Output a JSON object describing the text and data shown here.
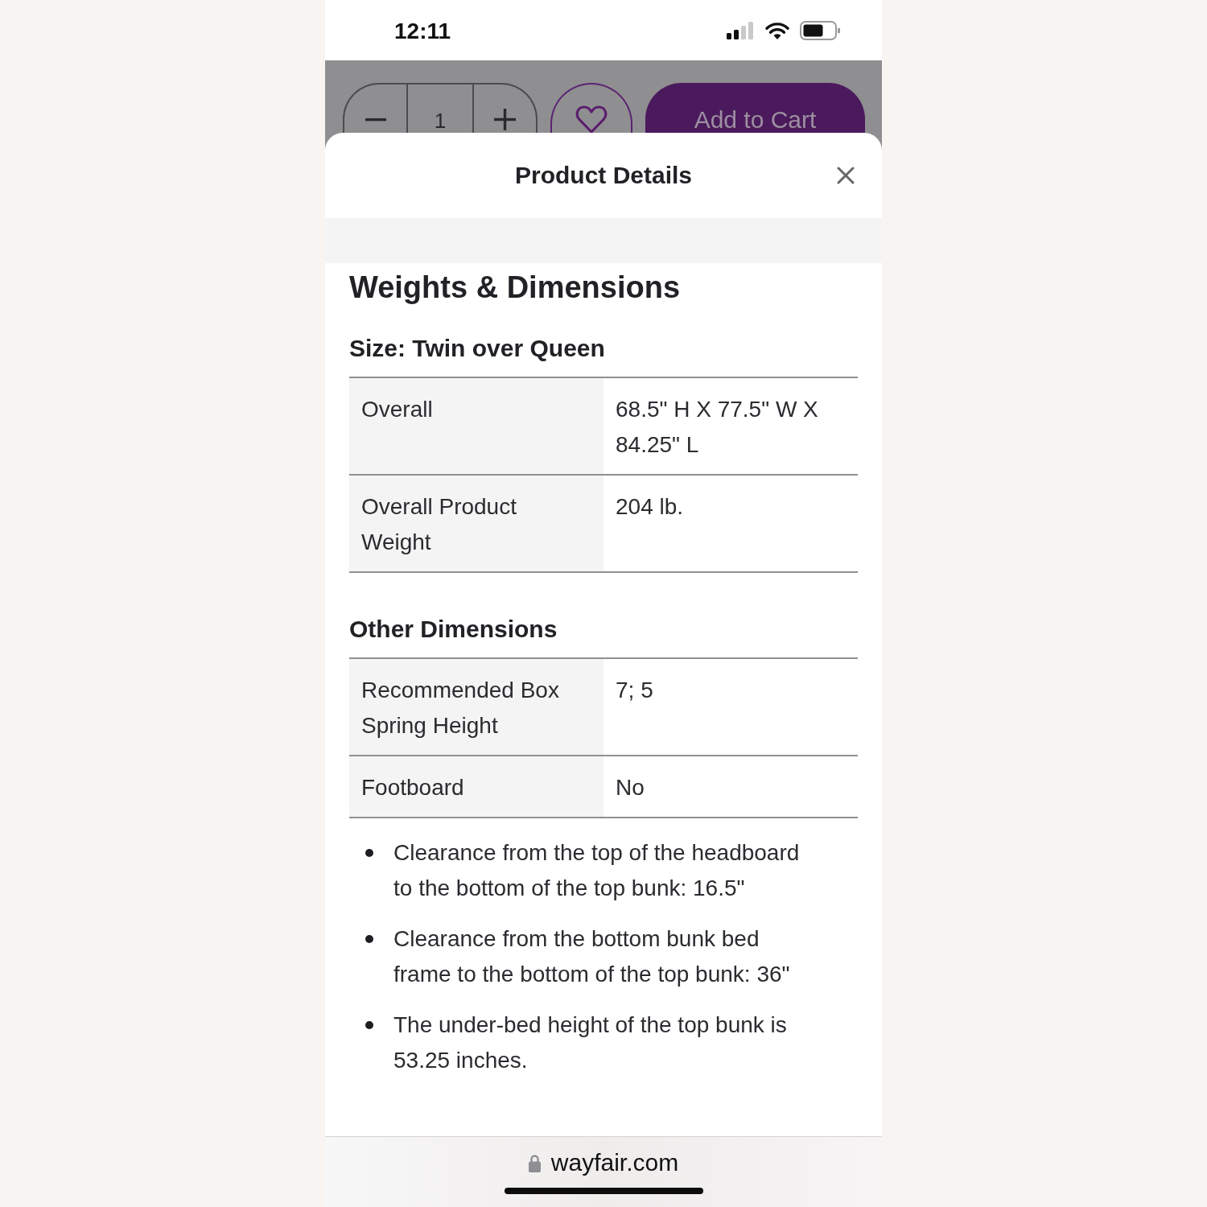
{
  "status_bar": {
    "time": "12:11"
  },
  "product_actions": {
    "quantity": "1",
    "favorited": false,
    "add_to_cart": "Add to Cart"
  },
  "sheet": {
    "title": "Product Details",
    "section_title": "Weights & Dimensions",
    "groups": [
      {
        "title": "Size: Twin over Queen",
        "rows": [
          {
            "label": "Overall",
            "value": "68.5\" H X 77.5\" W X 84.25\" L"
          },
          {
            "label": "Overall Product Weight",
            "value": "204 lb."
          }
        ]
      },
      {
        "title": "Other Dimensions",
        "rows": [
          {
            "label": "Recommended Box Spring Height",
            "value": "7; 5"
          },
          {
            "label": "Footboard",
            "value": "No"
          }
        ]
      }
    ],
    "notes": [
      "Clearance from the top of the headboard to the bottom of the top bunk: 16.5\"",
      "Clearance from the bottom bunk bed frame to the bottom of the top bunk: 36\"",
      "The under-bed height of the top bunk is 53.25 inches."
    ]
  },
  "browser_bar": {
    "url": "wayfair.com"
  }
}
